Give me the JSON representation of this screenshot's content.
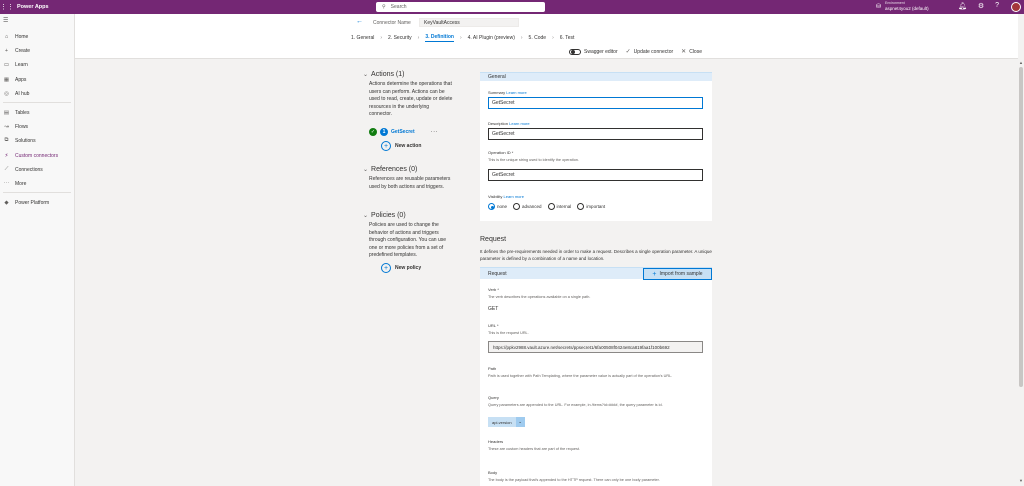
{
  "app": {
    "title": "Power Apps",
    "waffle_icon": "waffle-icon"
  },
  "search": {
    "placeholder": "Search"
  },
  "environment": {
    "label": "Environment",
    "name": "aspnet4you2 (default)"
  },
  "topbar_icons": [
    "environment-icon",
    "bell-icon",
    "gear-icon",
    "help-icon"
  ],
  "nav": {
    "items": [
      {
        "label": "Home",
        "icon": "home-icon"
      },
      {
        "label": "Create",
        "icon": "plus-icon"
      },
      {
        "label": "Learn",
        "icon": "book-icon"
      },
      {
        "label": "Apps",
        "icon": "apps-icon"
      },
      {
        "label": "AI hub",
        "icon": "ai-hub-icon"
      },
      {
        "label": "Tables",
        "icon": "table-icon"
      },
      {
        "label": "Flows",
        "icon": "flow-icon"
      },
      {
        "label": "Solutions",
        "icon": "solutions-icon"
      },
      {
        "label": "Custom connectors",
        "icon": "connector-icon",
        "active": true
      },
      {
        "label": "Connections",
        "icon": "connection-icon"
      },
      {
        "label": "More",
        "icon": "more-icon"
      },
      {
        "label": "Power Platform",
        "icon": "power-platform-icon"
      }
    ]
  },
  "wizard": {
    "connector_label": "Connector Name",
    "connector_name": "KeyVaultAccess",
    "steps": [
      "1. General",
      "2. Security",
      "3. Definition",
      "4. AI Plugin (preview)",
      "5. Code",
      "6. Test"
    ],
    "active_step": 2,
    "swagger_label": "Swagger editor",
    "update_label": "Update connector",
    "close_label": "Close"
  },
  "actions": {
    "title": "Actions (1)",
    "description": "Actions determine the operations that users can perform. Actions can be used to read, create, update or delete resources in the underlying connector.",
    "item_index": "1",
    "item_name": "GetSecret",
    "new_label": "New action"
  },
  "references": {
    "title": "References (0)",
    "description": "References are reusable parameters used by both actions and triggers."
  },
  "policies": {
    "title": "Policies (0)",
    "description": "Policies are used to change the behavior of actions and triggers through configuration. You can use one or more policies from a set of predefined templates.",
    "new_label": "New policy"
  },
  "general": {
    "header": "General",
    "summary_label": "Summary",
    "learn_more": "Learn more",
    "summary_value": "GetSecret",
    "description_label": "Description",
    "description_value": "GetSecret",
    "operation_id_label": "Operation ID *",
    "operation_id_help": "This is the unique string used to identify the operation.",
    "operation_id_value": "GetSecret",
    "visibility_label": "Visibility",
    "visibility_options": [
      "none",
      "advanced",
      "internal",
      "important"
    ],
    "visibility_selected": "none"
  },
  "request": {
    "title": "Request",
    "description": "It defines the pre-requirements needed in order to make a request. Describes a single operation parameter. A unique parameter is defined by a combination of a name and location.",
    "header": "Request",
    "import_label": "Import from sample",
    "verb_label": "Verb *",
    "verb_help": "The verb describes the operations available on a single path.",
    "verb_value": "GET",
    "url_label": "URL *",
    "url_help": "This is the request URL.",
    "url_value": "https://ppkv2988.vault.azure.net/secrets/ppsecret1/6fa00508f0424e8ca819faa1f100b692",
    "path_label": "Path",
    "path_help": "Path is used together with Path Templating, where the parameter value is actually part of the operation's URL.",
    "query_label": "Query",
    "query_help": "Query parameters are appended to the URL. For example, in /items?id=####, the query parameter is id.",
    "query_chip": "api-version",
    "headers_label": "Headers",
    "headers_help": "These are custom headers that are part of the request.",
    "body_label": "Body",
    "body_help": "The body is the payload that's appended to the HTTP request. There can only be one body parameter."
  }
}
